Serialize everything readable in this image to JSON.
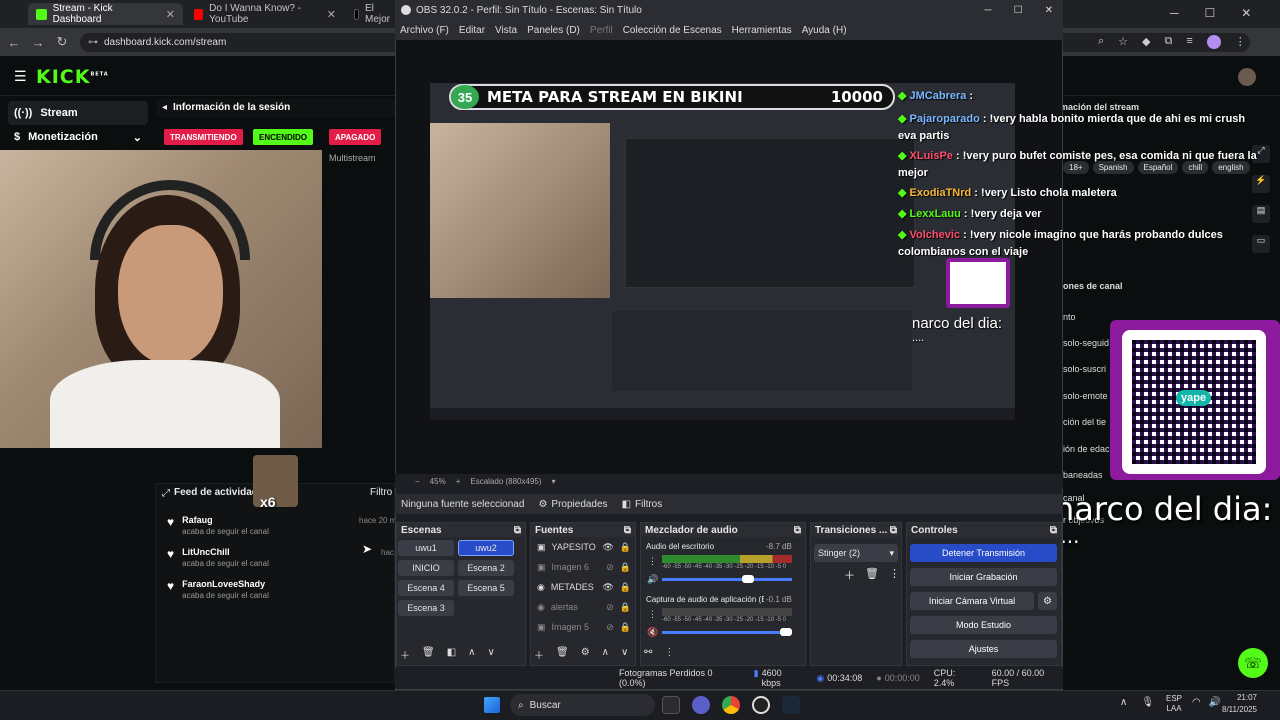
{
  "browser": {
    "tabs": [
      {
        "label": "Stream - Kick Dashboard",
        "active": true,
        "icon": "kick-favicon"
      },
      {
        "label": "Do I Wanna Know? - YouTube",
        "active": false,
        "icon": "youtube-favicon"
      },
      {
        "label": "El Mejor",
        "active": false,
        "icon": "tiktok-favicon"
      }
    ],
    "url": "dashboard.kick.com/stream"
  },
  "kick": {
    "logo": "KICK",
    "logo_sup": "BETA",
    "sidebar": [
      {
        "label": "Stream",
        "icon": "stream-icon"
      },
      {
        "label": "Monetización",
        "icon": "money-icon"
      }
    ],
    "session_title": "Información de la sesión",
    "pills": {
      "live": "TRANSMITIENDO",
      "on": "ENCENDIDO",
      "off": "APAGADO"
    },
    "multistream": "Multistream",
    "feed_title": "Feed de actividades",
    "filter": "Filtro",
    "feed": [
      {
        "name": "Rafaug",
        "sub": "acaba de seguir el canal",
        "time": "hace 20 m"
      },
      {
        "name": "LitUncChill",
        "sub": "acaba de seguir el canal",
        "time": "hac"
      },
      {
        "name": "FaraonLoveeShady",
        "sub": "acaba de seguir el canal",
        "time": ""
      }
    ],
    "right": {
      "header": "mación del stream",
      "tags": [
        "18+",
        "Spanish",
        "Español",
        "chill",
        "english"
      ],
      "section": "ones de canal",
      "items": [
        "nto",
        "solo-seguid",
        "solo-suscri",
        "solo-emote",
        "ción del tie",
        "ión de edac",
        "baneadas",
        "canal",
        "r objetivos"
      ]
    }
  },
  "overlay": {
    "goal_number": "35",
    "goal_text": "META PARA STREAM EN BIKINI",
    "goal_target": "10000",
    "chat": [
      {
        "user": "JMCabrera",
        "msg": ""
      },
      {
        "user": "Pajaroparado",
        "msg": "!very habla bonito mierda que de ahi es mi crush eva partis"
      },
      {
        "user": "XLuisPe",
        "msg": "!very puro bufet comiste pes, esa comida ni que fuera la mejor"
      },
      {
        "user": "ExodiaTNrd",
        "msg": "!very Listo chola maletera"
      },
      {
        "user": "LexxLauu",
        "msg": "!very deja ver"
      },
      {
        "user": "Volchevic",
        "msg": "!very nicole imagino que harás probando dulces colombianos con el viaje"
      }
    ],
    "narco": "narco del dia:",
    "dots": "....",
    "yape": "yape",
    "x6": "x6"
  },
  "obs": {
    "title": "OBS 32.0.2 - Perfil: Sin Título - Escenas: Sin Título",
    "menu": [
      "Archivo (F)",
      "Editar",
      "Vista",
      "Paneles (D)",
      "Perfil",
      "Colección de Escenas",
      "Herramientas",
      "Ayuda (H)"
    ],
    "zoom": "45%",
    "scale": "Escalado (880x495)",
    "no_source": "Ninguna fuente seleccionad",
    "properties": "Propiedades",
    "filters": "Filtros",
    "docks": {
      "scenes": "Escenas",
      "sources": "Fuentes",
      "mixer": "Mezclador de audio",
      "transitions": "Transiciones ...",
      "controls": "Controles"
    },
    "scenes": [
      "uwu1",
      "uwu2",
      "INICIO",
      "Escena 2",
      "Escena 4",
      "Escena 5",
      "Escena 3"
    ],
    "sources": [
      "YAPESITO",
      "Imagen 6",
      "METADES",
      "alertas",
      "Imagen 5"
    ],
    "mixer": [
      {
        "name": "Audio del escritorio",
        "db": "-8.7 dB"
      },
      {
        "name": "Captura de audio de aplicación (BE",
        "db": "-0.1 dB"
      }
    ],
    "meter_scale": "-60 -55 -50 -45 -40 -35 -30 -25 -20 -15 -10 -5 0",
    "transition": "Stinger (2)",
    "controls": [
      "Detener Transmisión",
      "Iniciar Grabación",
      "Iniciar Cámara Virtual",
      "Modo Estudio",
      "Ajustes"
    ],
    "status": {
      "frames": "Fotogramas Perdidos 0 (0.0%)",
      "kbps": "4600 kbps",
      "stream_time": "00:34:08",
      "rec_time": "00:00:00",
      "cpu": "CPU: 2.4%",
      "fps": "60.00 / 60.00 FPS"
    }
  },
  "taskbar": {
    "search": "Buscar",
    "lang": "ESP",
    "lang2": "LAA",
    "time": "21:07",
    "date": "8/11/2025"
  }
}
